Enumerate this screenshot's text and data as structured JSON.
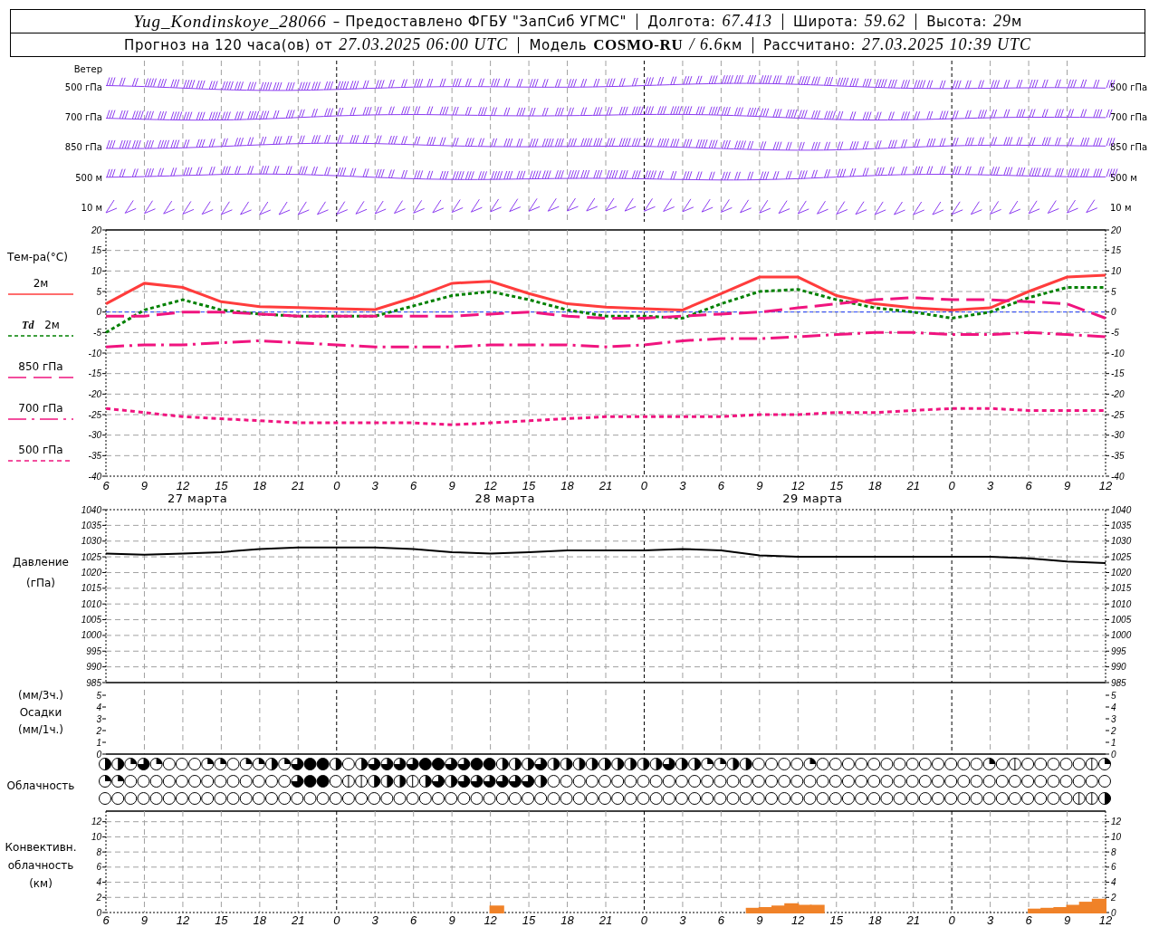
{
  "header": {
    "station": "Yug_Kondinskoye_28066",
    "provider": "– Предоставлено ФГБУ \"ЗапСиб УГМС\"",
    "fields": [
      {
        "label": "Долгота:",
        "value": "67.413"
      },
      {
        "label": "Широта:",
        "value": "59.62"
      },
      {
        "label": "Высота:",
        "value": "29",
        "unit": "м"
      }
    ],
    "forecast": {
      "label": "Прогноз на 120 часа(ов) от",
      "value": "27.03.2025 06:00 UTC"
    },
    "model": {
      "label": "Модель",
      "name": "COSMO-RU",
      "resolution": "/ 6.6",
      "unit": "км"
    },
    "computed": {
      "label": "Рассчитано:",
      "value": "27.03.2025 10:39 UTC"
    }
  },
  "wind": {
    "title": "Ветер",
    "levels": [
      {
        "label": "500 гПа",
        "right_label": "500 гПа",
        "kind": "barbs"
      },
      {
        "label": "700 гПа",
        "right_label": "700 гПа",
        "kind": "barbs"
      },
      {
        "label": "850 гПа",
        "right_label": "850 гПа",
        "kind": "barbs"
      },
      {
        "label": "500 м",
        "right_label": "500 м",
        "kind": "barbs"
      },
      {
        "label": "10  м",
        "right_label": "10  м",
        "kind": "zigzag"
      }
    ]
  },
  "temperature": {
    "title": "Тем-ра(°С)",
    "right_yticks": [
      "20",
      "15",
      "10",
      "5",
      "0",
      "-5",
      "-10",
      "-15",
      "-20",
      "-25",
      "-30",
      "-35",
      "-40"
    ],
    "day_labels": [
      "27 марта",
      "28 марта",
      "29 марта"
    ],
    "chart_data": {
      "type": "line",
      "grid": true,
      "categories": [
        "6",
        "9",
        "12",
        "15",
        "18",
        "21",
        "0",
        "3",
        "6",
        "9",
        "12",
        "15",
        "18",
        "21",
        "0",
        "3",
        "6",
        "9",
        "12",
        "15",
        "18",
        "21",
        "0",
        "3",
        "6",
        "9",
        "12"
      ],
      "ylim": [
        -40,
        20
      ],
      "ref_lines": [
        {
          "axis": "y",
          "value": 0,
          "color": "#2040ff",
          "line_style": "dotted"
        }
      ],
      "yticks": [
        20,
        15,
        10,
        5,
        0,
        -5,
        -10,
        -15,
        -20,
        -25,
        -30,
        -35,
        -40
      ],
      "series": [
        {
          "name": "2м",
          "color": "#ff3c3c",
          "line_style": "solid",
          "values": [
            2,
            7,
            6,
            2.5,
            1.3,
            1.1,
            0.8,
            0.6,
            3.5,
            7,
            7.5,
            4.5,
            2,
            1.2,
            0.8,
            0.5,
            4.5,
            8.5,
            8.5,
            4,
            2,
            1,
            0.5,
            1,
            5,
            8.5,
            9
          ]
        },
        {
          "name": "**Td** 2м",
          "color": "#008000",
          "line_style": "dotted",
          "values": [
            -5,
            0.5,
            3,
            0.5,
            -0.5,
            -1,
            -1,
            -1,
            1.5,
            4,
            5,
            3,
            0.5,
            -1,
            -1,
            -1.5,
            2,
            5,
            5.5,
            3,
            1,
            0,
            -1.5,
            0,
            3.5,
            6,
            6
          ]
        },
        {
          "name": "850 гПа",
          "color": "#f0147f",
          "line_style": "dashed",
          "values": [
            -1,
            -1,
            0,
            0,
            -0.5,
            -1,
            -1,
            -1,
            -1,
            -1,
            -0.5,
            0,
            -1,
            -1.5,
            -1.5,
            -1,
            -0.5,
            0,
            1,
            2,
            3,
            3.5,
            3,
            3,
            2.5,
            2,
            -1.5
          ]
        },
        {
          "name": "700 гПа",
          "color": "#f0147f",
          "line_style": "dashdot",
          "values": [
            -8.5,
            -8,
            -8,
            -7.5,
            -7,
            -7.5,
            -8,
            -8.5,
            -8.5,
            -8.5,
            -8,
            -8,
            -8,
            -8.5,
            -8,
            -7,
            -6.5,
            -6.5,
            -6,
            -5.5,
            -5,
            -5,
            -5.5,
            -5.5,
            -5,
            -5.5,
            -6
          ]
        },
        {
          "name": "500 гПа",
          "color": "#f0147f",
          "line_style": "densely dashed",
          "values": [
            -23.5,
            -24.5,
            -25.5,
            -26,
            -26.5,
            -27,
            -27,
            -27,
            -27,
            -27.5,
            -27,
            -26.5,
            -26,
            -25.5,
            -25.5,
            -25.5,
            -25.5,
            -25,
            -25,
            -24.5,
            -24.5,
            -24,
            -23.5,
            -23.5,
            -24,
            -24,
            -24
          ]
        }
      ]
    }
  },
  "pressure": {
    "title": [
      "Давление",
      "(гПа)"
    ],
    "right_yticks": [
      "1040",
      "1035",
      "1030",
      "1025",
      "1020",
      "1015",
      "1010",
      "1005",
      "1000",
      "995",
      "990",
      "985"
    ],
    "chart_data": {
      "type": "line",
      "grid": true,
      "categories": [
        null,
        null,
        null,
        null,
        null,
        null,
        null,
        null,
        null,
        null,
        null,
        null,
        null,
        null,
        null,
        null,
        null,
        null,
        null,
        null,
        null,
        null,
        null,
        null,
        null,
        null,
        null
      ],
      "ylim": [
        985,
        1040
      ],
      "yticks": [
        1040,
        1035,
        1030,
        1025,
        1020,
        1015,
        1010,
        1005,
        1000,
        995,
        990,
        985
      ],
      "series": [
        {
          "color": "#000000",
          "values": [
            1026,
            1025.7,
            1026,
            1026.5,
            1027.5,
            1028,
            1028,
            1028,
            1027.5,
            1026.5,
            1026,
            1026.5,
            1027,
            1027,
            1027,
            1027.5,
            1027,
            1025.5,
            1025,
            1025,
            1025,
            1025,
            1025,
            1025,
            1024.5,
            1023.5,
            1023
          ]
        }
      ]
    }
  },
  "precipitation": {
    "title": [
      "(мм/3ч.)",
      "Осадки",
      "(мм/1ч.)"
    ],
    "left_yticks": [
      "5",
      "4",
      "3",
      "2",
      "1",
      "0"
    ],
    "right_yticks": [
      "5",
      "4",
      "3",
      "2",
      "1",
      "0"
    ]
  },
  "cloudiness": {
    "title": "Облачность",
    "rows": [
      {
        "cells": [
          {
            "kind": "half"
          },
          {
            "kind": "half"
          },
          {
            "kind": "quarter"
          },
          {
            "kind": "most"
          },
          {
            "kind": "quarter"
          },
          {
            "kind": "clear"
          },
          {
            "kind": "clear"
          },
          {
            "kind": "clear"
          },
          {
            "kind": "quarter"
          },
          {
            "kind": "quarter"
          },
          {
            "kind": "clear"
          },
          {
            "kind": "quarter"
          },
          {
            "kind": "quarter"
          },
          {
            "kind": "half"
          },
          {
            "kind": "quarter"
          },
          {
            "kind": "most"
          },
          {
            "kind": "full"
          },
          {
            "kind": "full"
          },
          {
            "kind": "half"
          },
          {
            "kind": "clear"
          },
          {
            "kind": "half"
          },
          {
            "kind": "most"
          },
          {
            "kind": "most"
          },
          {
            "kind": "most"
          },
          {
            "kind": "most"
          },
          {
            "kind": "full"
          },
          {
            "kind": "full"
          },
          {
            "kind": "most"
          },
          {
            "kind": "most"
          },
          {
            "kind": "full"
          },
          {
            "kind": "full"
          },
          {
            "kind": "half"
          },
          {
            "kind": "half"
          },
          {
            "kind": "half"
          },
          {
            "kind": "most"
          },
          {
            "kind": "half"
          },
          {
            "kind": "half"
          },
          {
            "kind": "half"
          },
          {
            "kind": "half"
          },
          {
            "kind": "half"
          },
          {
            "kind": "half"
          },
          {
            "kind": "half"
          },
          {
            "kind": "half"
          },
          {
            "kind": "half"
          },
          {
            "kind": "most"
          },
          {
            "kind": "half"
          },
          {
            "kind": "half"
          },
          {
            "kind": "quarter"
          },
          {
            "kind": "quarter"
          },
          {
            "kind": "half"
          },
          {
            "kind": "half"
          },
          {
            "kind": "clear"
          },
          {
            "kind": "clear"
          },
          {
            "kind": "clear"
          },
          {
            "kind": "clear"
          },
          {
            "kind": "quarter"
          },
          {
            "kind": "clear"
          },
          {
            "kind": "clear"
          },
          {
            "kind": "clear"
          },
          {
            "kind": "clear"
          },
          {
            "kind": "clear"
          },
          {
            "kind": "clear"
          },
          {
            "kind": "clear"
          },
          {
            "kind": "clear"
          },
          {
            "kind": "clear"
          },
          {
            "kind": "clear"
          },
          {
            "kind": "clear"
          },
          {
            "kind": "clear"
          },
          {
            "kind": "clear"
          },
          {
            "kind": "quarter"
          },
          {
            "kind": "clear"
          },
          {
            "kind": "trace"
          },
          {
            "kind": "clear"
          },
          {
            "kind": "clear"
          },
          {
            "kind": "clear"
          },
          {
            "kind": "clear"
          },
          {
            "kind": "clear"
          },
          {
            "kind": "trace"
          },
          {
            "kind": "quarter"
          }
        ]
      },
      {
        "cells": [
          {
            "kind": "quarter"
          },
          {
            "kind": "quarter"
          },
          {
            "kind": "clear"
          },
          {
            "kind": "clear"
          },
          {
            "kind": "clear"
          },
          {
            "kind": "clear"
          },
          {
            "kind": "clear"
          },
          {
            "kind": "clear"
          },
          {
            "kind": "clear"
          },
          {
            "kind": "clear"
          },
          {
            "kind": "clear"
          },
          {
            "kind": "clear"
          },
          {
            "kind": "clear"
          },
          {
            "kind": "clear"
          },
          {
            "kind": "clear"
          },
          {
            "kind": "most"
          },
          {
            "kind": "full"
          },
          {
            "kind": "full"
          },
          {
            "kind": "clear"
          },
          {
            "kind": "trace"
          },
          {
            "kind": "trace"
          },
          {
            "kind": "half"
          },
          {
            "kind": "half"
          },
          {
            "kind": "half"
          },
          {
            "kind": "trace"
          },
          {
            "kind": "half"
          },
          {
            "kind": "most"
          },
          {
            "kind": "half"
          },
          {
            "kind": "most"
          },
          {
            "kind": "most"
          },
          {
            "kind": "most"
          },
          {
            "kind": "most"
          },
          {
            "kind": "most"
          },
          {
            "kind": "most"
          },
          {
            "kind": "half"
          },
          {
            "kind": "clear"
          },
          {
            "kind": "clear"
          },
          {
            "kind": "clear"
          },
          {
            "kind": "clear"
          },
          {
            "kind": "clear"
          },
          {
            "kind": "clear"
          },
          {
            "kind": "clear"
          },
          {
            "kind": "clear"
          },
          {
            "kind": "clear"
          },
          {
            "kind": "clear"
          },
          {
            "kind": "clear"
          },
          {
            "kind": "clear"
          },
          {
            "kind": "clear"
          },
          {
            "kind": "clear"
          },
          {
            "kind": "clear"
          },
          {
            "kind": "clear"
          },
          {
            "kind": "clear"
          },
          {
            "kind": "clear"
          },
          {
            "kind": "clear"
          },
          {
            "kind": "clear"
          },
          {
            "kind": "clear"
          },
          {
            "kind": "clear"
          },
          {
            "kind": "clear"
          },
          {
            "kind": "clear"
          },
          {
            "kind": "clear"
          },
          {
            "kind": "clear"
          },
          {
            "kind": "clear"
          },
          {
            "kind": "clear"
          },
          {
            "kind": "clear"
          },
          {
            "kind": "clear"
          },
          {
            "kind": "clear"
          },
          {
            "kind": "clear"
          },
          {
            "kind": "clear"
          },
          {
            "kind": "clear"
          },
          {
            "kind": "clear"
          },
          {
            "kind": "clear"
          },
          {
            "kind": "clear"
          },
          {
            "kind": "clear"
          },
          {
            "kind": "clear"
          },
          {
            "kind": "clear"
          },
          {
            "kind": "clear"
          },
          {
            "kind": "clear"
          },
          {
            "kind": "clear"
          },
          {
            "kind": "clear"
          }
        ]
      },
      {
        "cells": [
          {
            "kind": "clear"
          },
          {
            "kind": "clear"
          },
          {
            "kind": "clear"
          },
          {
            "kind": "clear"
          },
          {
            "kind": "clear"
          },
          {
            "kind": "clear"
          },
          {
            "kind": "clear"
          },
          {
            "kind": "clear"
          },
          {
            "kind": "clear"
          },
          {
            "kind": "clear"
          },
          {
            "kind": "clear"
          },
          {
            "kind": "clear"
          },
          {
            "kind": "clear"
          },
          {
            "kind": "clear"
          },
          {
            "kind": "clear"
          },
          {
            "kind": "clear"
          },
          {
            "kind": "clear"
          },
          {
            "kind": "clear"
          },
          {
            "kind": "clear"
          },
          {
            "kind": "clear"
          },
          {
            "kind": "clear"
          },
          {
            "kind": "clear"
          },
          {
            "kind": "clear"
          },
          {
            "kind": "clear"
          },
          {
            "kind": "clear"
          },
          {
            "kind": "clear"
          },
          {
            "kind": "clear"
          },
          {
            "kind": "clear"
          },
          {
            "kind": "clear"
          },
          {
            "kind": "clear"
          },
          {
            "kind": "clear"
          },
          {
            "kind": "clear"
          },
          {
            "kind": "clear"
          },
          {
            "kind": "clear"
          },
          {
            "kind": "clear"
          },
          {
            "kind": "clear"
          },
          {
            "kind": "clear"
          },
          {
            "kind": "clear"
          },
          {
            "kind": "clear"
          },
          {
            "kind": "clear"
          },
          {
            "kind": "clear"
          },
          {
            "kind": "clear"
          },
          {
            "kind": "clear"
          },
          {
            "kind": "clear"
          },
          {
            "kind": "clear"
          },
          {
            "kind": "clear"
          },
          {
            "kind": "clear"
          },
          {
            "kind": "clear"
          },
          {
            "kind": "clear"
          },
          {
            "kind": "clear"
          },
          {
            "kind": "clear"
          },
          {
            "kind": "clear"
          },
          {
            "kind": "clear"
          },
          {
            "kind": "clear"
          },
          {
            "kind": "clear"
          },
          {
            "kind": "clear"
          },
          {
            "kind": "clear"
          },
          {
            "kind": "clear"
          },
          {
            "kind": "clear"
          },
          {
            "kind": "clear"
          },
          {
            "kind": "clear"
          },
          {
            "kind": "clear"
          },
          {
            "kind": "clear"
          },
          {
            "kind": "clear"
          },
          {
            "kind": "clear"
          },
          {
            "kind": "clear"
          },
          {
            "kind": "clear"
          },
          {
            "kind": "clear"
          },
          {
            "kind": "clear"
          },
          {
            "kind": "clear"
          },
          {
            "kind": "clear"
          },
          {
            "kind": "clear"
          },
          {
            "kind": "clear"
          },
          {
            "kind": "clear"
          },
          {
            "kind": "clear"
          },
          {
            "kind": "clear"
          },
          {
            "kind": "trace"
          },
          {
            "kind": "trace"
          },
          {
            "kind": "half"
          }
        ]
      }
    ]
  },
  "convective": {
    "title": [
      "Конвективн.",
      "облачность",
      "(км)"
    ],
    "right_yticks": [
      "12",
      "10",
      "8",
      "6",
      "4",
      "2",
      "0"
    ],
    "chart_data": {
      "type": "bar",
      "grid": true,
      "ylim": [
        0,
        13.4
      ],
      "yticks": [
        12,
        10,
        8,
        6,
        4,
        2,
        0
      ],
      "categories": [
        "6",
        null,
        null,
        "9",
        null,
        null,
        "12",
        null,
        null,
        "15",
        null,
        null,
        "18",
        null,
        null,
        "21",
        null,
        null,
        "0",
        null,
        null,
        "3",
        null,
        null,
        "6",
        null,
        null,
        "9",
        null,
        null,
        "12",
        null,
        null,
        "15",
        null,
        null,
        "18",
        null,
        null,
        "21",
        null,
        null,
        "0",
        null,
        null,
        "3",
        null,
        null,
        "6",
        null,
        null,
        "9",
        null,
        null,
        "12",
        null,
        null,
        "15",
        null,
        null,
        "18",
        null,
        null,
        "21",
        null,
        null,
        "0",
        null,
        null,
        "3",
        null,
        null,
        "6",
        null,
        null,
        "9",
        null,
        null,
        "12"
      ],
      "series": [
        {
          "color": "#f08228",
          "values": [
            null,
            null,
            null,
            null,
            null,
            null,
            null,
            null,
            null,
            null,
            null,
            null,
            null,
            null,
            null,
            null,
            null,
            null,
            null,
            null,
            null,
            null,
            null,
            null,
            null,
            null,
            null,
            null,
            null,
            null,
            0.8,
            null,
            null,
            null,
            null,
            null,
            null,
            null,
            null,
            null,
            null,
            null,
            null,
            null,
            null,
            null,
            null,
            null,
            null,
            null,
            0.5,
            0.6,
            0.8,
            1.1,
            0.9,
            0.9,
            null,
            null,
            null,
            null,
            null,
            null,
            null,
            null,
            null,
            null,
            null,
            null,
            null,
            null,
            null,
            null,
            0.4,
            0.5,
            0.6,
            0.9,
            1.3,
            1.7,
            null
          ]
        }
      ]
    }
  }
}
